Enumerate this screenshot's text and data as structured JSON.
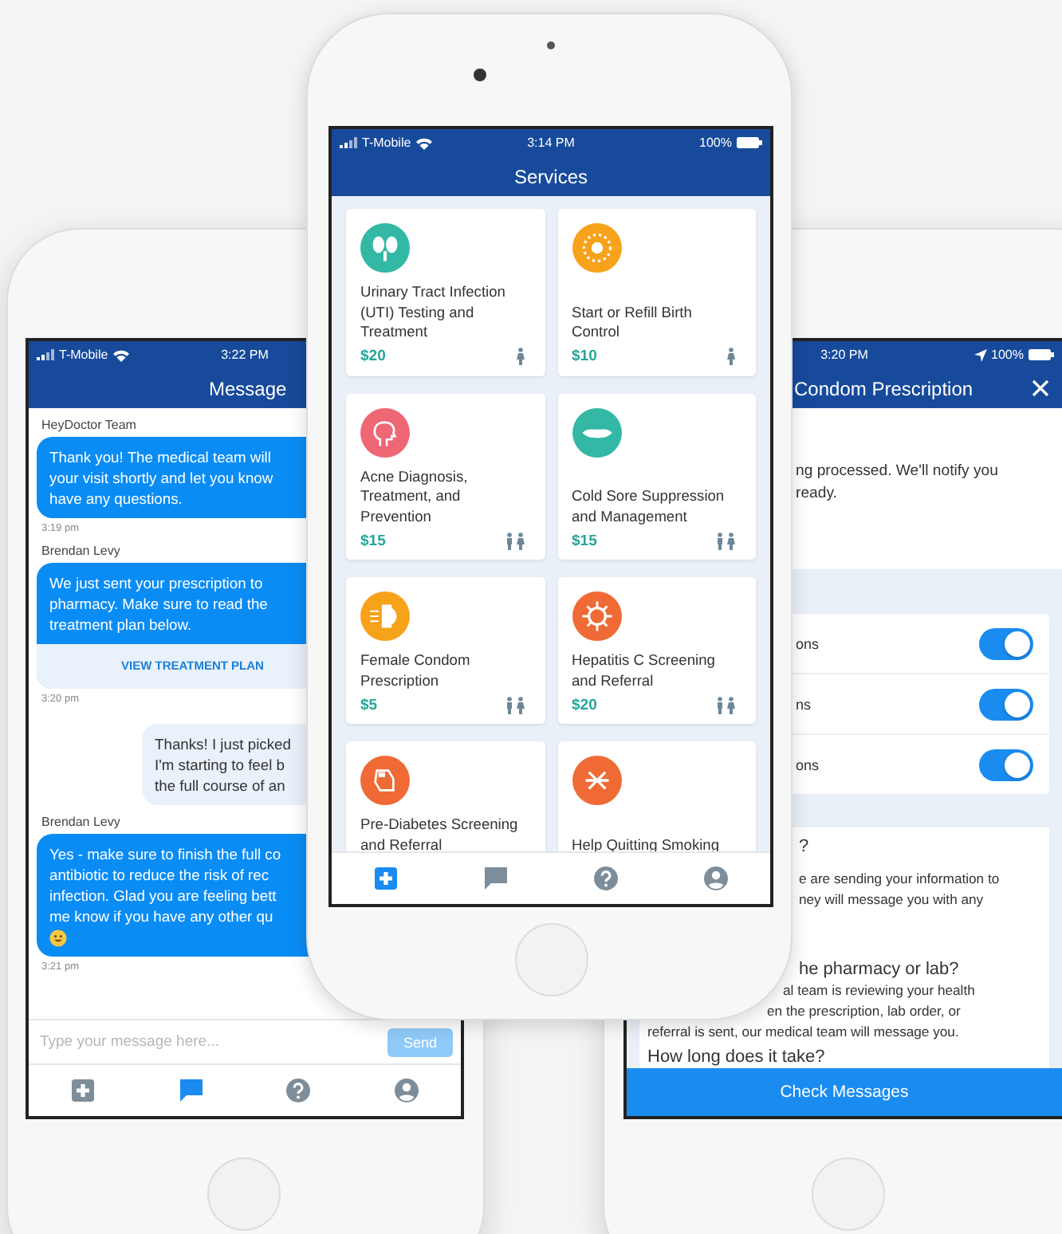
{
  "messages_phone": {
    "status_bar": {
      "carrier": "T-Mobile",
      "time": "3:22 PM"
    },
    "title": "Message",
    "messages": [
      {
        "kind": "incoming",
        "sender": "HeyDoctor Team",
        "text": "Thank you! The medical team will\nyour visit shortly and let you know\nhave any questions.",
        "time": "3:19 pm"
      },
      {
        "kind": "incoming",
        "sender": "Brendan Levy",
        "text": "We just sent your prescription to\npharmacy. Make sure to read the\ntreatment plan below.",
        "action": "VIEW TREATMENT PLAN",
        "time": "3:20 pm"
      },
      {
        "kind": "outgoing",
        "text": "Thanks! I just picked\nI'm starting to feel b\nthe full course of an"
      },
      {
        "kind": "incoming",
        "sender": "Brendan Levy",
        "text": "Yes - make sure to finish the full co\nantibiotic to reduce the risk of rec\ninfection. Glad you are feeling bett\nme know if you have any other qu",
        "emoji": true,
        "time": "3:21 pm"
      }
    ],
    "composer": {
      "placeholder": "Type your message here...",
      "send": "Send"
    },
    "tab_bar": [
      {
        "selected": false
      },
      {
        "selected": true
      },
      {
        "selected": false
      },
      {
        "selected": false
      }
    ]
  },
  "services_phone": {
    "status_bar": {
      "carrier": "T-Mobile",
      "time": "3:14 PM",
      "battery": "100%"
    },
    "title": "Services",
    "services": [
      {
        "name": "Urinary Tract Infection (UTI) Testing and Treatment",
        "price": "$20",
        "color": "#33b8a5",
        "kind": "single"
      },
      {
        "name": "Start or Refill Birth Control",
        "price": "$10",
        "color": "#f7a21b",
        "kind": "single"
      },
      {
        "name": "Acne Diagnosis, Treatment, and Prevention",
        "price": "$15",
        "color": "#ef6674",
        "kind": "couple"
      },
      {
        "name": "Cold Sore Suppression and Management",
        "price": "$15",
        "color": "#33b8a5",
        "kind": "couple"
      },
      {
        "name": "Female Condom Prescription",
        "price": "$5",
        "color": "#f7a21b",
        "kind": "couple"
      },
      {
        "name": "Hepatitis C Screening and Referral",
        "price": "$20",
        "color": "#ef6a35",
        "kind": "couple"
      },
      {
        "name": "Pre-Diabetes Screening and Referral",
        "color": "#ef6a35"
      },
      {
        "name": "Help Quitting Smoking",
        "color": "#ef6a35"
      }
    ],
    "tab_bar": [
      {
        "selected": true
      },
      {
        "selected": false
      },
      {
        "selected": false
      },
      {
        "selected": false
      }
    ]
  },
  "prescription_phone": {
    "status_bar": {
      "time": "3:20 PM",
      "battery": "100%"
    },
    "title": "Condom Prescription",
    "status_lines": [
      "ng processed. We'll notify you",
      "ready."
    ],
    "toggles": [
      {
        "label": "ons",
        "on": true
      },
      {
        "label": "ns",
        "on": true
      },
      {
        "label": "ons",
        "on": true
      }
    ],
    "faq": [
      {
        "kind": "heading",
        "text": "?"
      },
      {
        "kind": "body",
        "text": "e are sending your information to"
      },
      {
        "kind": "body",
        "text": "ney will message you with any"
      },
      {
        "kind": "heading",
        "text": "he pharmacy or lab?"
      },
      {
        "kind": "body",
        "text": "al team is reviewing your health"
      },
      {
        "kind": "body",
        "text": "en the prescription, lab order, or"
      },
      {
        "kind": "body",
        "text": "referral is sent, our medical team will message you."
      },
      {
        "kind": "heading",
        "text": "How long does it take?"
      }
    ],
    "button": "Check Messages"
  }
}
